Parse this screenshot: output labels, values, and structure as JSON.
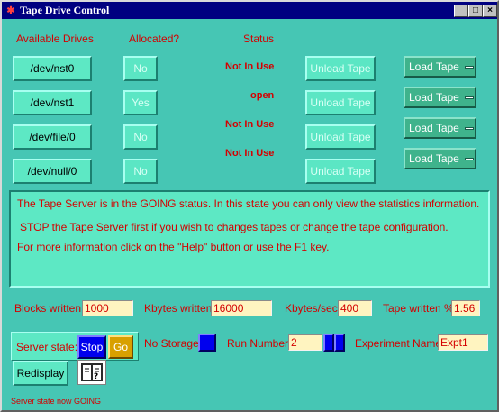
{
  "window": {
    "title": "Tape Drive Control",
    "controls": {
      "minimize": "_",
      "maximize": "□",
      "close": "×"
    }
  },
  "headers": {
    "drives": "Available Drives",
    "allocated": "Allocated?",
    "status": "Status"
  },
  "drives": [
    {
      "name": "/dev/nst0",
      "allocated": "No",
      "status": "Not In Use",
      "unload": "Unload Tape",
      "load": "Load Tape"
    },
    {
      "name": "/dev/nst1",
      "allocated": "Yes",
      "status": "open",
      "unload": "Unload Tape",
      "load": "Load Tape"
    },
    {
      "name": "/dev/file/0",
      "allocated": "No",
      "status": "Not In Use",
      "unload": "Unload Tape",
      "load": "Load Tape"
    },
    {
      "name": "/dev/null/0",
      "allocated": "No",
      "status": "Not In Use",
      "unload": "Unload Tape",
      "load": "Load Tape"
    }
  ],
  "message": {
    "line1": "The Tape Server is in the GOING status. In this state you can only view the statistics information.",
    "line2": "STOP the Tape Server first if you wish to changes tapes or change the tape configuration.",
    "line3": "For more information click on the \"Help\" button or use the F1 key."
  },
  "stats": {
    "blocks_label": "Blocks written:",
    "blocks_value": "1000",
    "kbytes_label": "Kbytes written:",
    "kbytes_value": "16000",
    "kbps_label": "Kbytes/sec:",
    "kbps_value": "400",
    "tapepct_label": "Tape written %",
    "tapepct_value": "1.56"
  },
  "controls": {
    "server_state_label": "Server state:",
    "stop": "Stop",
    "go": "Go",
    "no_storage_label": "No Storage",
    "run_number_label": "Run Number",
    "run_number_value": "2",
    "experiment_label": "Experiment Name",
    "experiment_value": "Expt1",
    "redisplay": "Redisplay"
  },
  "status_line": "Server state now GOING",
  "colors": {
    "background": "#46c6b4",
    "accent_red": "#d40000",
    "titlebar": "#000080",
    "stop_blue": "#0000ee",
    "go_gold": "#d8a000"
  },
  "icons": {
    "title": "tape-app-icon",
    "help": "help-book-icon"
  }
}
